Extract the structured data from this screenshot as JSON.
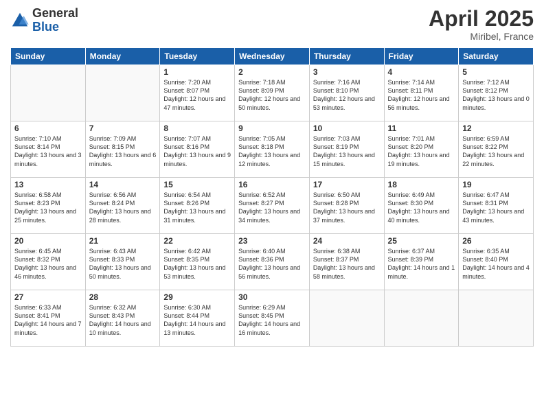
{
  "header": {
    "logo_general": "General",
    "logo_blue": "Blue",
    "month_title": "April 2025",
    "location": "Miribel, France"
  },
  "days_of_week": [
    "Sunday",
    "Monday",
    "Tuesday",
    "Wednesday",
    "Thursday",
    "Friday",
    "Saturday"
  ],
  "weeks": [
    [
      {
        "day": "",
        "content": ""
      },
      {
        "day": "",
        "content": ""
      },
      {
        "day": "1",
        "content": "Sunrise: 7:20 AM\nSunset: 8:07 PM\nDaylight: 12 hours and 47 minutes."
      },
      {
        "day": "2",
        "content": "Sunrise: 7:18 AM\nSunset: 8:09 PM\nDaylight: 12 hours and 50 minutes."
      },
      {
        "day": "3",
        "content": "Sunrise: 7:16 AM\nSunset: 8:10 PM\nDaylight: 12 hours and 53 minutes."
      },
      {
        "day": "4",
        "content": "Sunrise: 7:14 AM\nSunset: 8:11 PM\nDaylight: 12 hours and 56 minutes."
      },
      {
        "day": "5",
        "content": "Sunrise: 7:12 AM\nSunset: 8:12 PM\nDaylight: 13 hours and 0 minutes."
      }
    ],
    [
      {
        "day": "6",
        "content": "Sunrise: 7:10 AM\nSunset: 8:14 PM\nDaylight: 13 hours and 3 minutes."
      },
      {
        "day": "7",
        "content": "Sunrise: 7:09 AM\nSunset: 8:15 PM\nDaylight: 13 hours and 6 minutes."
      },
      {
        "day": "8",
        "content": "Sunrise: 7:07 AM\nSunset: 8:16 PM\nDaylight: 13 hours and 9 minutes."
      },
      {
        "day": "9",
        "content": "Sunrise: 7:05 AM\nSunset: 8:18 PM\nDaylight: 13 hours and 12 minutes."
      },
      {
        "day": "10",
        "content": "Sunrise: 7:03 AM\nSunset: 8:19 PM\nDaylight: 13 hours and 15 minutes."
      },
      {
        "day": "11",
        "content": "Sunrise: 7:01 AM\nSunset: 8:20 PM\nDaylight: 13 hours and 19 minutes."
      },
      {
        "day": "12",
        "content": "Sunrise: 6:59 AM\nSunset: 8:22 PM\nDaylight: 13 hours and 22 minutes."
      }
    ],
    [
      {
        "day": "13",
        "content": "Sunrise: 6:58 AM\nSunset: 8:23 PM\nDaylight: 13 hours and 25 minutes."
      },
      {
        "day": "14",
        "content": "Sunrise: 6:56 AM\nSunset: 8:24 PM\nDaylight: 13 hours and 28 minutes."
      },
      {
        "day": "15",
        "content": "Sunrise: 6:54 AM\nSunset: 8:26 PM\nDaylight: 13 hours and 31 minutes."
      },
      {
        "day": "16",
        "content": "Sunrise: 6:52 AM\nSunset: 8:27 PM\nDaylight: 13 hours and 34 minutes."
      },
      {
        "day": "17",
        "content": "Sunrise: 6:50 AM\nSunset: 8:28 PM\nDaylight: 13 hours and 37 minutes."
      },
      {
        "day": "18",
        "content": "Sunrise: 6:49 AM\nSunset: 8:30 PM\nDaylight: 13 hours and 40 minutes."
      },
      {
        "day": "19",
        "content": "Sunrise: 6:47 AM\nSunset: 8:31 PM\nDaylight: 13 hours and 43 minutes."
      }
    ],
    [
      {
        "day": "20",
        "content": "Sunrise: 6:45 AM\nSunset: 8:32 PM\nDaylight: 13 hours and 46 minutes."
      },
      {
        "day": "21",
        "content": "Sunrise: 6:43 AM\nSunset: 8:33 PM\nDaylight: 13 hours and 50 minutes."
      },
      {
        "day": "22",
        "content": "Sunrise: 6:42 AM\nSunset: 8:35 PM\nDaylight: 13 hours and 53 minutes."
      },
      {
        "day": "23",
        "content": "Sunrise: 6:40 AM\nSunset: 8:36 PM\nDaylight: 13 hours and 56 minutes."
      },
      {
        "day": "24",
        "content": "Sunrise: 6:38 AM\nSunset: 8:37 PM\nDaylight: 13 hours and 58 minutes."
      },
      {
        "day": "25",
        "content": "Sunrise: 6:37 AM\nSunset: 8:39 PM\nDaylight: 14 hours and 1 minute."
      },
      {
        "day": "26",
        "content": "Sunrise: 6:35 AM\nSunset: 8:40 PM\nDaylight: 14 hours and 4 minutes."
      }
    ],
    [
      {
        "day": "27",
        "content": "Sunrise: 6:33 AM\nSunset: 8:41 PM\nDaylight: 14 hours and 7 minutes."
      },
      {
        "day": "28",
        "content": "Sunrise: 6:32 AM\nSunset: 8:43 PM\nDaylight: 14 hours and 10 minutes."
      },
      {
        "day": "29",
        "content": "Sunrise: 6:30 AM\nSunset: 8:44 PM\nDaylight: 14 hours and 13 minutes."
      },
      {
        "day": "30",
        "content": "Sunrise: 6:29 AM\nSunset: 8:45 PM\nDaylight: 14 hours and 16 minutes."
      },
      {
        "day": "",
        "content": ""
      },
      {
        "day": "",
        "content": ""
      },
      {
        "day": "",
        "content": ""
      }
    ]
  ]
}
